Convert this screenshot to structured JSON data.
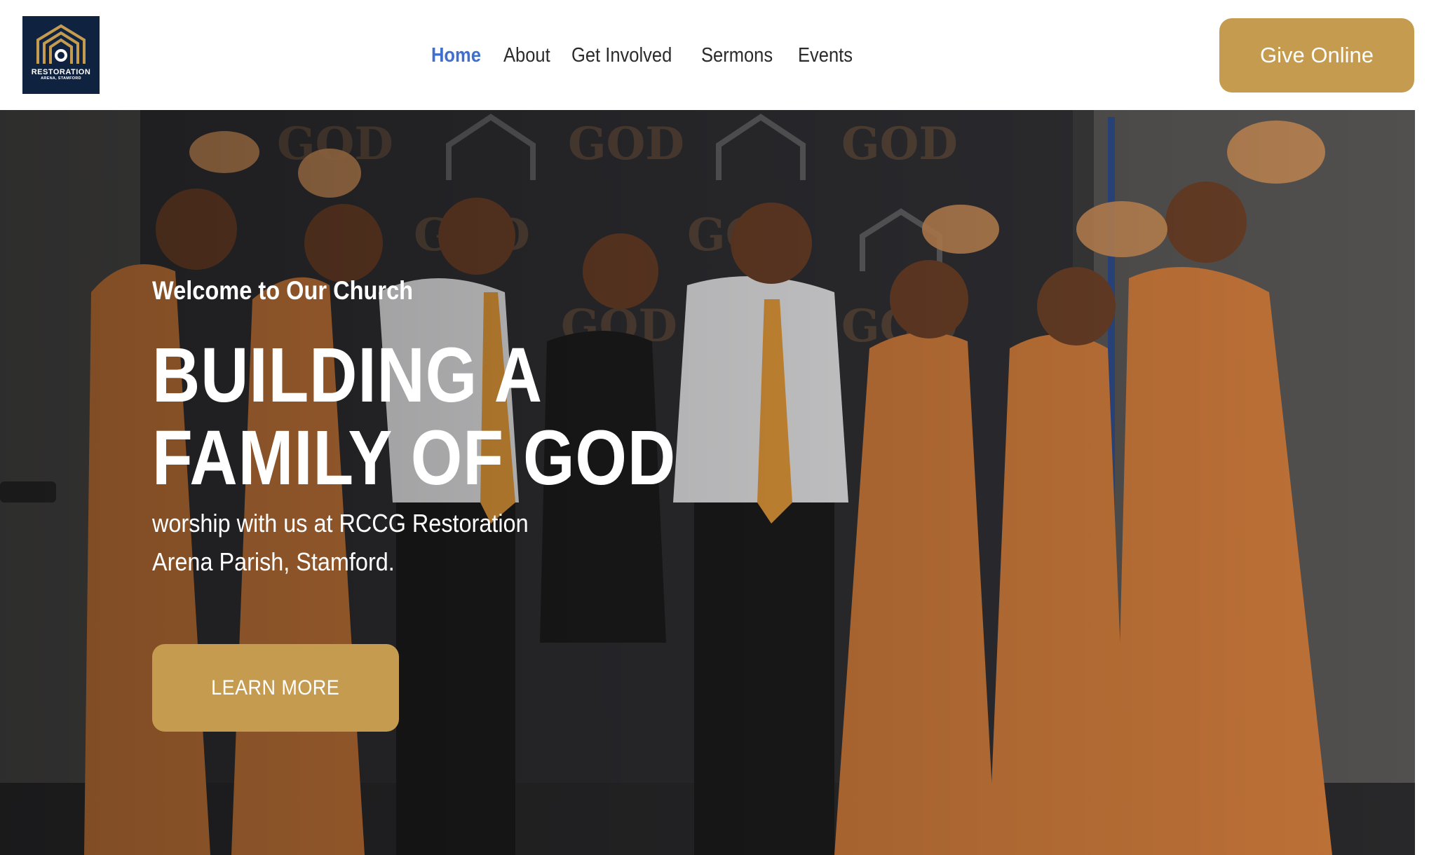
{
  "header": {
    "logo": {
      "name": "RESTORATION",
      "subtitle": "ARENA, STAMFORD",
      "background": "#0f2340",
      "accent": "#c59b50"
    },
    "nav": [
      {
        "label": "Home",
        "active": true
      },
      {
        "label": "About",
        "active": false
      },
      {
        "label": "Get Involved",
        "active": false
      },
      {
        "label": "Sermons",
        "active": false
      },
      {
        "label": "Events",
        "active": false
      }
    ],
    "give_button": "Give Online"
  },
  "hero": {
    "kicker": "Welcome to Our Church",
    "title_line1": "BUILDING A",
    "title_line2": "FAMILY OF GOD",
    "subtitle": "worship with us at RCCG Restoration Arena Parish, Stamford.",
    "cta": "LEARN MORE",
    "photo_subject": "church-group-photo"
  },
  "colors": {
    "accent_gold": "#c59b50",
    "nav_active": "#3f6fcf",
    "nav_text": "#2b2b2b",
    "dress_orange": "#c9783a"
  }
}
